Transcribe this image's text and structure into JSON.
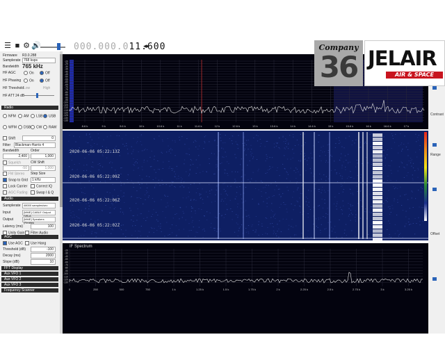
{
  "toolbar": {
    "frequency_dim": "000.000.0",
    "frequency_bright": "11.600",
    "arrows": "◂▸"
  },
  "left_panel": {
    "firmware_label": "Firmware",
    "firmware_value": "R3.0.288",
    "samplerate_label": "Samplerate",
    "samplerate_value": "768 ksps",
    "bandwidth_label": "Bandwidth",
    "bandwidth_value": "765 kHz",
    "hf_agc_label": "HF AGC",
    "hf_agc_on": "On",
    "hf_agc_off": "Off",
    "hf_phasing_label": "HF Phasing",
    "hf_phasing_on": "On",
    "hf_phasing_off": "Off",
    "hf_threshold_label": "HF Threshold",
    "hf_threshold_low": "Low",
    "hf_threshold_high": "High",
    "hf_att_label": "HF ATT 24 dB",
    "radio_section": "Radio",
    "modes_row1": [
      "NFM",
      "AM",
      "LSB",
      "USB"
    ],
    "modes_row2": [
      "WFM",
      "DSB",
      "CW",
      "RAW"
    ],
    "shift_label": "Shift",
    "shift_value": "0",
    "filter_label": "Filter",
    "filter_value": "Blackman-Harris 4",
    "bandwidth2_label": "Bandwidth",
    "order_label": "Order",
    "bandwidth2_value": "2,400",
    "order_value": "1,000",
    "squelch_label": "Squelch",
    "cw_shift_label": "CW Shift",
    "squelch_value": "-50",
    "cw_shift_value": "1,000",
    "fm_stereo_label": "FM Stereo",
    "step_size_label": "Step Size",
    "snap_label": "Snap to Grid",
    "snap_value": "1 kHz",
    "lock_label": "Lock Carrier",
    "correct_label": "Correct IQ",
    "agc_fading_label": "AGC Fading",
    "swap_label": "Swap I & Q",
    "audio_section": "Audio",
    "audio_samplerate_label": "Samplerate",
    "audio_samplerate_value": "48000 samples/sec",
    "input_label": "Input",
    "input_value": "[MME] CABLE Output (VB-A",
    "output_label": "Output",
    "output_value": "[MME] Speakers (Realtek",
    "latency_label": "Latency (ms)",
    "latency_value": "100",
    "unity_gain_label": "Unity Gain",
    "filter_audio_label": "Filter Audio",
    "agc_section": "AGC",
    "use_agc_label": "Use AGC",
    "use_hang_label": "Use Hang",
    "threshold_label": "Threshold (dB)",
    "threshold_value": "-100",
    "decay_label": "Decay (ms)",
    "decay_value": "2000",
    "slope_label": "Slope (dB)",
    "slope_value": "10",
    "fft_display_section": "FFT Display",
    "aux_vfo1_section": "Aux VFO 1",
    "aux_vfo2_section": "Aux VFO 2",
    "aux_vfo3_section": "Aux VFO 3",
    "frequency_scanner_section": "Frequency Scanner"
  },
  "spectrum": {
    "y_ticks": [
      "-20",
      "-25",
      "-30",
      "-35",
      "-40",
      "-45",
      "-50",
      "-55",
      "-60",
      "-65",
      "-70",
      "-75",
      "-80",
      "-85",
      "-90",
      "-95",
      "-100",
      "-105",
      "-110",
      "-115",
      "-120",
      "-125",
      "-130",
      "-135"
    ],
    "x_ticks": [
      "8.6 k",
      "9 k",
      "9.6 k",
      "10 k",
      "10.6 k",
      "11 k",
      "11.6 k",
      "12 k",
      "12.6 k",
      "13 k",
      "13.6 k",
      "14 k",
      "14.6 k",
      "15 k",
      "15.6 k",
      "16 k",
      "16.6 k",
      "17 k"
    ]
  },
  "waterfall": {
    "timestamps": [
      "2020-06-06 05:22:13Z",
      "2020-06-06 05:22:09Z",
      "2020-06-06 05:22:06Z",
      "2020-06-06 05:22:02Z"
    ]
  },
  "if_spectrum": {
    "title": "IF Spectrum",
    "y_ticks": [
      "-20",
      "-30",
      "-40",
      "-50",
      "-60",
      "-70",
      "-80",
      "-90",
      "-100",
      "-110",
      "-120",
      "-130"
    ],
    "x_ticks": [
      "0",
      "250",
      "500",
      "750",
      "1 k",
      "1.25 k",
      "1.5 k",
      "1.75 k",
      "2 k",
      "2.25 k",
      "2.5 k",
      "2.75 k",
      "3 k",
      "3.25 k"
    ]
  },
  "right_panel": {
    "contrast_label": "Contrast",
    "range_label": "Range",
    "offset_label": "Offset"
  },
  "logos": {
    "company_text": "Company",
    "company_number": "36",
    "jelair_name": "JELAIR",
    "jelair_tag": "AIR & SPACE"
  }
}
